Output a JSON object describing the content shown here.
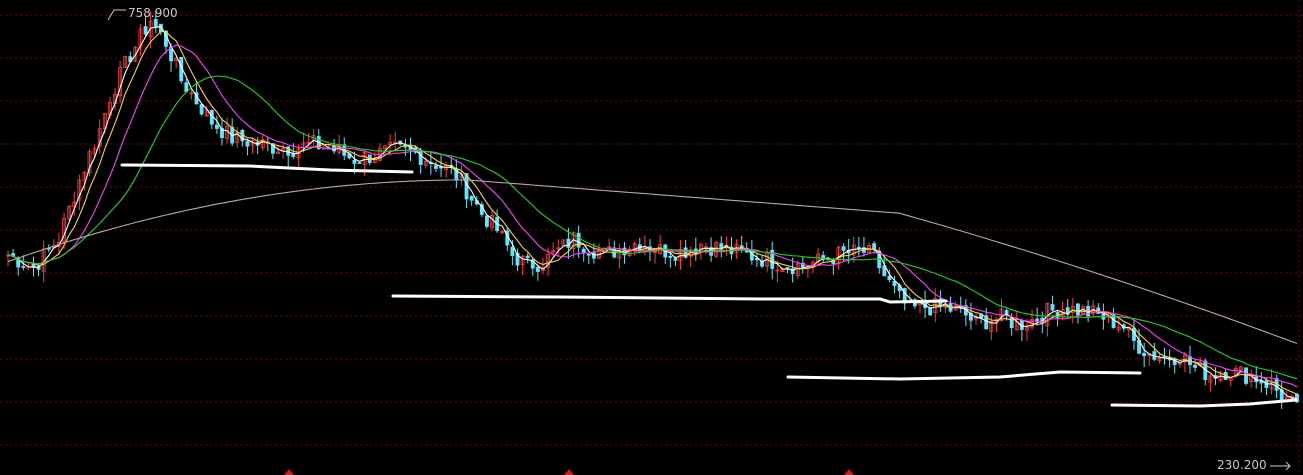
{
  "chart_data": {
    "type": "candlestick",
    "title": "",
    "xlabel": "",
    "ylabel": "",
    "ylim": [
      230.2,
      758.9
    ],
    "grid": true,
    "legend": "none",
    "annotations": {
      "max_price_label": "758.900",
      "min_price_label": "230.200"
    },
    "colors": {
      "background": "#000000",
      "grid": "#7a0000",
      "candle_up": "#ff3b3b",
      "candle_down": "#5fe6ff",
      "ma_white": "#ffffff",
      "ma_yellow": "#ffd23a",
      "ma_magenta": "#ff3cff",
      "ma_green": "#19d619",
      "ma_long": "#b5a8a8",
      "support_lines": "#ffffff"
    },
    "close_series": [
      [
        0,
        470
      ],
      [
        5,
        455
      ],
      [
        10,
        490
      ],
      [
        14,
        560
      ],
      [
        18,
        620
      ],
      [
        20,
        660
      ],
      [
        24,
        710
      ],
      [
        28,
        752
      ],
      [
        31,
        725
      ],
      [
        34,
        680
      ],
      [
        37,
        655
      ],
      [
        40,
        630
      ],
      [
        44,
        610
      ],
      [
        48,
        605
      ],
      [
        52,
        600
      ],
      [
        56,
        598
      ],
      [
        60,
        603
      ],
      [
        64,
        596
      ],
      [
        68,
        585
      ],
      [
        72,
        590
      ],
      [
        76,
        596
      ],
      [
        80,
        592
      ],
      [
        84,
        580
      ],
      [
        88,
        566
      ],
      [
        90,
        548
      ],
      [
        93,
        520
      ],
      [
        96,
        500
      ],
      [
        99,
        470
      ],
      [
        102,
        458
      ],
      [
        105,
        462
      ],
      [
        108,
        475
      ],
      [
        111,
        490
      ],
      [
        114,
        480
      ],
      [
        117,
        470
      ],
      [
        120,
        478
      ],
      [
        124,
        486
      ],
      [
        128,
        476
      ],
      [
        132,
        474
      ],
      [
        136,
        483
      ],
      [
        140,
        478
      ],
      [
        144,
        472
      ],
      [
        148,
        466
      ],
      [
        152,
        460
      ],
      [
        156,
        456
      ],
      [
        160,
        464
      ],
      [
        164,
        472
      ],
      [
        168,
        474
      ],
      [
        170,
        468
      ],
      [
        172,
        445
      ],
      [
        175,
        418
      ],
      [
        177,
        405
      ],
      [
        180,
        408
      ],
      [
        183,
        407
      ],
      [
        186,
        404
      ],
      [
        188,
        398
      ],
      [
        190,
        388
      ],
      [
        193,
        393
      ],
      [
        196,
        395
      ],
      [
        198,
        386
      ],
      [
        201,
        392
      ],
      [
        204,
        402
      ],
      [
        207,
        407
      ],
      [
        210,
        404
      ],
      [
        213,
        400
      ],
      [
        216,
        393
      ],
      [
        219,
        384
      ],
      [
        221,
        366
      ],
      [
        224,
        352
      ],
      [
        227,
        347
      ],
      [
        230,
        350
      ],
      [
        233,
        334
      ],
      [
        236,
        327
      ],
      [
        239,
        331
      ],
      [
        242,
        328
      ],
      [
        245,
        323
      ],
      [
        248,
        314
      ],
      [
        250,
        302
      ],
      [
        252,
        292
      ],
      [
        253,
        284
      ]
    ],
    "moving_average_lines": 5,
    "support_lines_drawn": 4
  }
}
